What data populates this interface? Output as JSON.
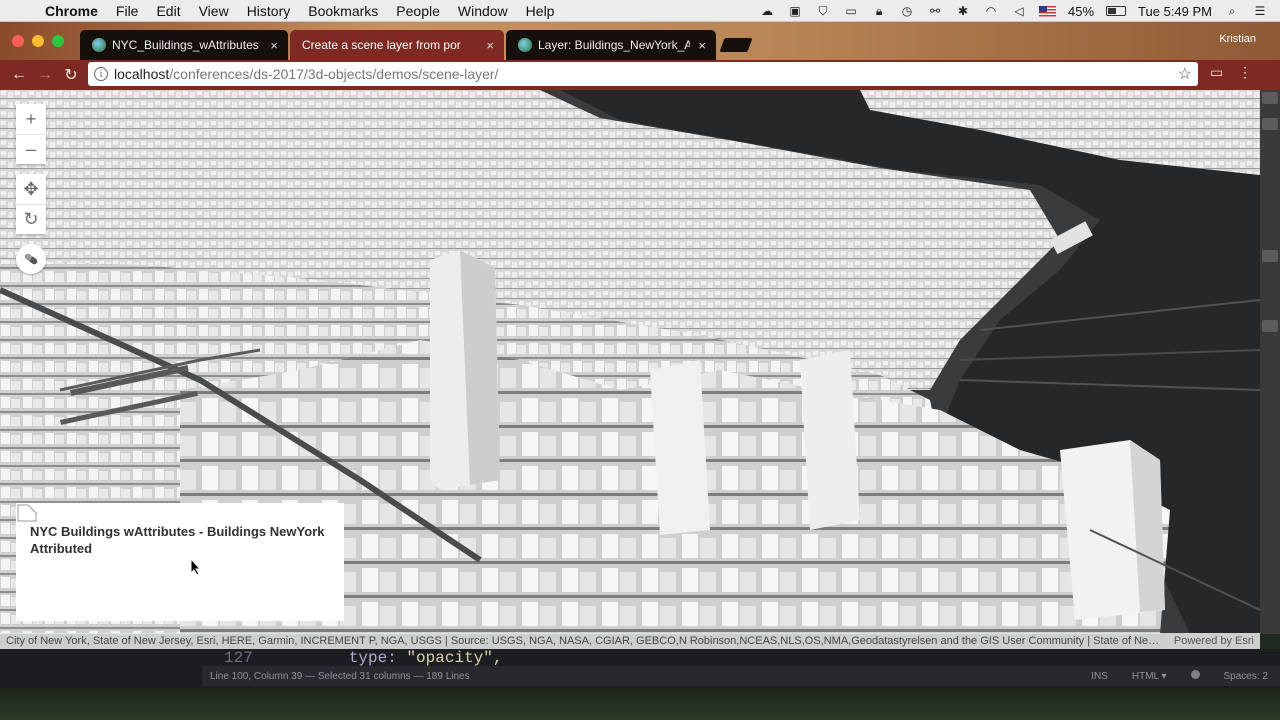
{
  "menubar": {
    "app": "Chrome",
    "items": [
      "File",
      "Edit",
      "View",
      "History",
      "Bookmarks",
      "People",
      "Window",
      "Help"
    ],
    "battery": "45%",
    "clock": "Tue 5:49 PM"
  },
  "browser": {
    "tabs": [
      {
        "label": "NYC_Buildings_wAttributes",
        "close": "×"
      },
      {
        "label": "Create a scene layer from por",
        "close": "×"
      },
      {
        "label": "Layer: Buildings_NewYork_Attr",
        "close": "×"
      }
    ],
    "profile": "Kristian",
    "url_host": "localhost",
    "url_path": "/conferences/ds-2017/3d-objects/demos/scene-layer/"
  },
  "scene": {
    "zoom_in": "+",
    "zoom_out": "–",
    "pan": "✥",
    "rotate": "↻",
    "legend_title": "NYC Buildings wAttributes - Buildings NewYork Attributed",
    "attribution": "City of New York, State of New Jersey, Esri, HERE, Garmin, INCREMENT P, NGA, USGS | Source: USGS, NGA, NASA, CGIAR, GEBCO,N Robinson,NCEAS,NLS,OS,NMA,Geodatastyrelsen and the GIS User Community | State of New Je...",
    "powered_by": "Powered by Esri"
  },
  "editor": {
    "line_number": "127",
    "code_key": "type:",
    "code_value": "\"opacity\",",
    "status_position": "Line 100, Column 39 — Selected 31 columns — 189 Lines",
    "mode_ins": "INS",
    "mode_lang": "HTML ▾",
    "spaces": "Spaces: 2"
  }
}
